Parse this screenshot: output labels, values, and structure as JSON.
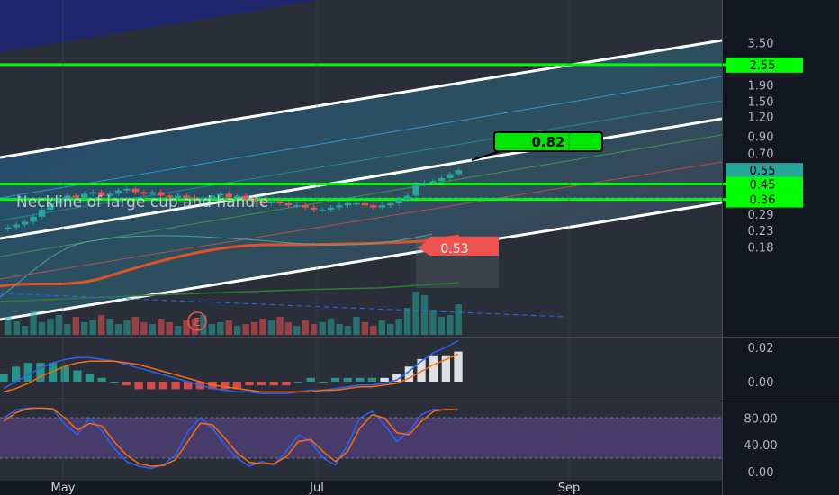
{
  "chart_data": {
    "type": "line",
    "price_panel": {
      "scale": "log",
      "y_ticks": [
        "3.50",
        "1.90",
        "1.50",
        "1.20",
        "0.90",
        "0.70",
        "0.29",
        "0.23",
        "0.18"
      ],
      "level_labels": [
        {
          "text": "2.55",
          "value": 2.55,
          "color": "#00ff00"
        },
        {
          "text": "0.55",
          "value": 0.55,
          "color": "#26a69a"
        },
        {
          "text": "0.45",
          "value": 0.45,
          "color": "#00ff00"
        },
        {
          "text": "0.36",
          "value": 0.36,
          "color": "#00ff00"
        }
      ],
      "horizontal_levels": [
        2.55,
        0.45,
        0.36
      ],
      "annotation_neckline": "Neckline of large cup and handle",
      "target_label": "0.82",
      "target_value": 0.82,
      "price_marker_label": "0.53",
      "earnings_marker": "E",
      "candles_close": [
        0.24,
        0.25,
        0.26,
        0.28,
        0.31,
        0.34,
        0.36,
        0.38,
        0.37,
        0.39,
        0.4,
        0.38,
        0.39,
        0.41,
        0.42,
        0.4,
        0.39,
        0.4,
        0.38,
        0.37,
        0.38,
        0.37,
        0.36,
        0.37,
        0.38,
        0.39,
        0.37,
        0.38,
        0.36,
        0.35,
        0.34,
        0.35,
        0.34,
        0.33,
        0.33,
        0.32,
        0.31,
        0.31,
        0.32,
        0.33,
        0.34,
        0.34,
        0.33,
        0.32,
        0.33,
        0.34,
        0.36,
        0.38,
        0.45,
        0.46,
        0.47,
        0.49,
        0.52,
        0.55
      ]
    },
    "macd_panel": {
      "y_ticks": [
        "0.02",
        "0.00"
      ],
      "macd": [
        -0.004,
        0.0,
        0.004,
        0.008,
        0.011,
        0.013,
        0.014,
        0.014,
        0.013,
        0.012,
        0.01,
        0.008,
        0.006,
        0.004,
        0.002,
        0.0,
        -0.002,
        -0.004,
        -0.005,
        -0.006,
        -0.006,
        -0.007,
        -0.007,
        -0.007,
        -0.006,
        -0.005,
        -0.005,
        -0.004,
        -0.003,
        -0.002,
        -0.002,
        -0.001,
        0.001,
        0.006,
        0.012,
        0.017,
        0.02,
        0.024
      ],
      "signal": [
        -0.006,
        -0.004,
        -0.001,
        0.003,
        0.006,
        0.009,
        0.011,
        0.012,
        0.012,
        0.012,
        0.011,
        0.01,
        0.008,
        0.006,
        0.004,
        0.002,
        0.0,
        -0.002,
        -0.003,
        -0.004,
        -0.005,
        -0.006,
        -0.006,
        -0.006,
        -0.006,
        -0.006,
        -0.005,
        -0.005,
        -0.004,
        -0.003,
        -0.003,
        -0.002,
        -0.001,
        0.002,
        0.006,
        0.01,
        0.013,
        0.016
      ]
    },
    "stoch_panel": {
      "y_ticks": [
        "80.00",
        "40.00",
        "0.00"
      ],
      "band": [
        20,
        80
      ],
      "k": [
        80,
        92,
        95,
        95,
        93,
        70,
        55,
        80,
        60,
        35,
        15,
        8,
        5,
        10,
        25,
        60,
        80,
        65,
        40,
        20,
        8,
        15,
        10,
        30,
        55,
        45,
        20,
        10,
        40,
        80,
        90,
        70,
        45,
        60,
        85,
        93,
        92,
        93
      ],
      "d": [
        75,
        88,
        94,
        95,
        94,
        80,
        62,
        72,
        68,
        45,
        25,
        12,
        8,
        9,
        18,
        45,
        72,
        70,
        50,
        28,
        14,
        12,
        12,
        22,
        45,
        48,
        30,
        15,
        30,
        65,
        85,
        80,
        58,
        55,
        75,
        90,
        93,
        92
      ]
    },
    "x_ticks": [
      "May",
      "Jul",
      "Sep"
    ],
    "colors": {
      "up": "#26a69a",
      "down": "#ef5350",
      "level": "#00ff00",
      "macd": "#2962ff",
      "signal": "#ff6d00",
      "stoch_band": "#7e57c2"
    }
  }
}
